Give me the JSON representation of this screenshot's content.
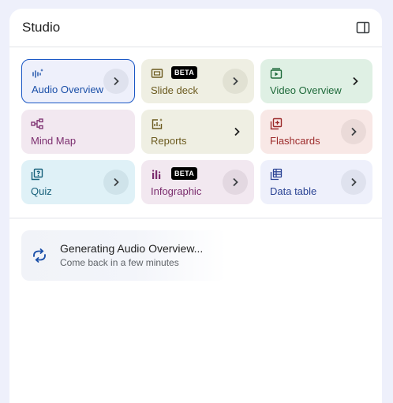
{
  "panel": {
    "title": "Studio"
  },
  "tiles": [
    {
      "label": "Audio Overview",
      "icon": "audio-waveform-icon",
      "bg": "#eef0fb",
      "fg": "#1a4fa8",
      "selected": true
    },
    {
      "label": "Slide deck",
      "icon": "slides-icon",
      "badge": "BETA",
      "bg": "#efefe3",
      "fg": "#6b5a1e"
    },
    {
      "label": "Video Overview",
      "icon": "video-icon",
      "bg": "#dff0e4",
      "fg": "#1e6a3a"
    },
    {
      "label": "Mind Map",
      "icon": "mind-map-icon",
      "bg": "#f2e8f0",
      "fg": "#7b2d6e"
    },
    {
      "label": "Reports",
      "icon": "reports-icon",
      "bg": "#efefe3",
      "fg": "#6b5a1e"
    },
    {
      "label": "Flashcards",
      "icon": "flashcards-icon",
      "bg": "#f8e8e6",
      "fg": "#9c2b2b"
    },
    {
      "label": "Quiz",
      "icon": "quiz-icon",
      "bg": "#dff1f7",
      "fg": "#16607a"
    },
    {
      "label": "Infographic",
      "icon": "infographic-icon",
      "badge": "BETA",
      "bg": "#f2e8f0",
      "fg": "#7b2d6e"
    },
    {
      "label": "Data table",
      "icon": "data-table-icon",
      "bg": "#eef0fb",
      "fg": "#2a4394"
    }
  ],
  "generating": {
    "title": "Generating Audio Overview...",
    "subtitle": "Come back in a few minutes"
  }
}
